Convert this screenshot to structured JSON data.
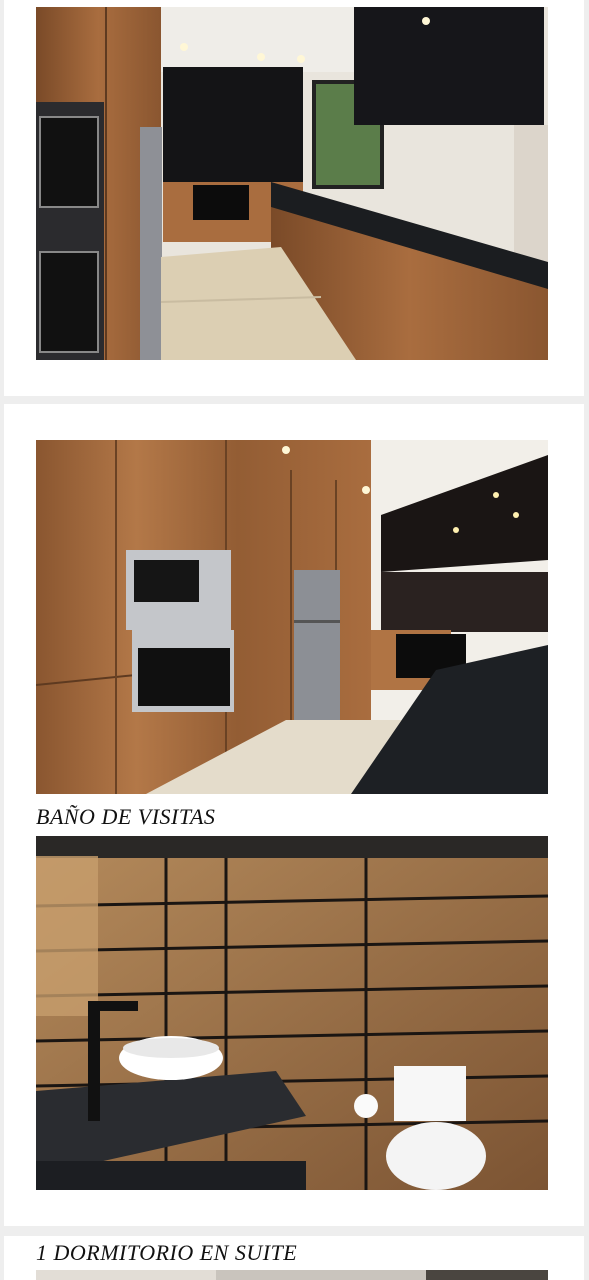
{
  "sections": [
    {
      "photo": "kitchen-galley-photo"
    },
    {
      "photo": "kitchen-appliance-wall-photo"
    },
    {
      "title": "BAÑO DE VISITAS",
      "photo": "guest-bathroom-photo"
    },
    {
      "title": "1 DORMITORIO EN SUITE",
      "photo": "bedroom-suite-photo"
    }
  ],
  "colors": {
    "page_background": "#eeeeee",
    "card_background": "#ffffff",
    "wood": "#a0663a",
    "granite": "#1d2024"
  }
}
